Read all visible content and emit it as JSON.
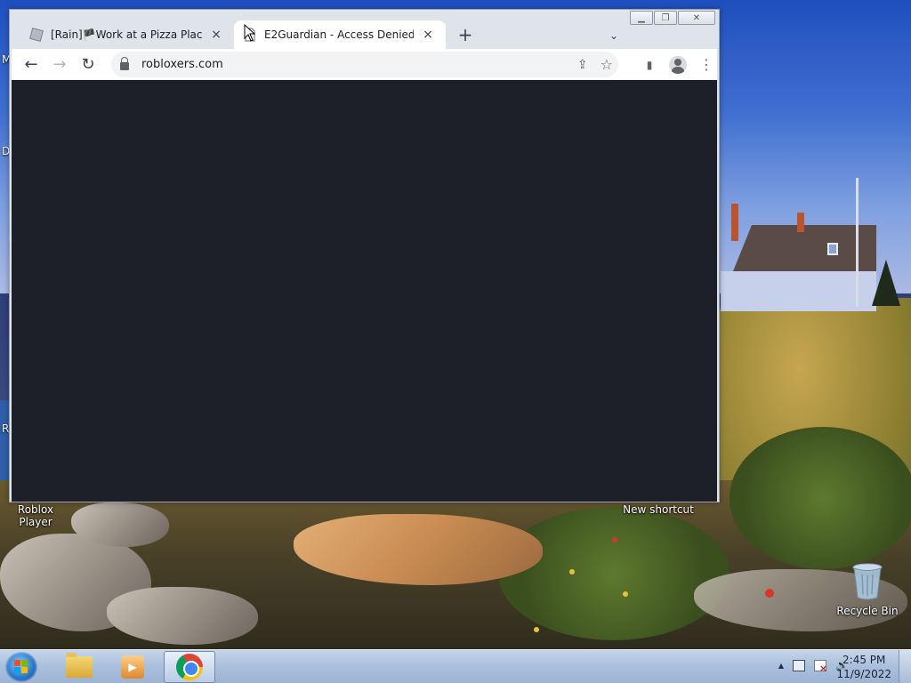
{
  "desktop": {
    "icons": {
      "roblox_player": "Roblox Player",
      "new_shortcut": "New shortcut",
      "recycle_bin": "Recycle Bin"
    },
    "edge_letters": [
      "M",
      "D",
      "R"
    ]
  },
  "browser": {
    "tabs": [
      {
        "title": "[Rain]🏴Work at a Pizza Place - Roblox",
        "favicon": "roblox-icon"
      },
      {
        "title": "E2Guardian - Access Denied",
        "favicon": "page-icon"
      }
    ],
    "new_tab_symbol": "+",
    "tab_search_symbol": "⌄",
    "tab_close_symbol": "×",
    "address_bar": {
      "url": "robloxers.com"
    },
    "nav": {
      "back": "←",
      "forward": "→",
      "reload": "↻"
    },
    "toolbar_icons": {
      "share": "⇪",
      "bookmark": "☆",
      "side_panel": "▮",
      "menu": "⋮"
    },
    "caption": {
      "minimize": "▁",
      "restore": "❐",
      "close": "✕"
    },
    "content_color": "#1e2029"
  },
  "taskbar": {
    "pinned": [
      "windows-explorer-icon",
      "windows-media-player-icon",
      "chrome-icon"
    ],
    "clock": {
      "time": "2:45 PM",
      "date": "11/9/2022"
    },
    "tray_arrow": "▲",
    "volume": "🔊"
  }
}
